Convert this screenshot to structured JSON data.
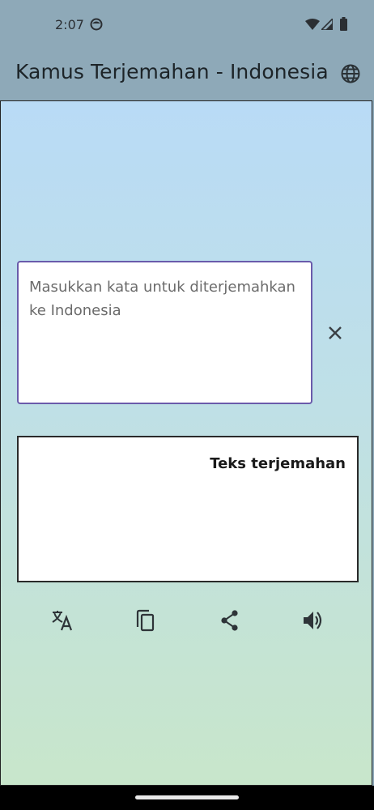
{
  "status_bar": {
    "time": "2:07",
    "icons": [
      "face-icon",
      "wifi-icon",
      "signal-icon",
      "battery-icon"
    ]
  },
  "app_bar": {
    "title": "Kamus Terjemahan - Indonesia",
    "language_button_icon": "globe-icon"
  },
  "input": {
    "placeholder": "Masukkan kata untuk diterjemahkan ke Indonesia",
    "value": "",
    "clear_icon": "close-icon"
  },
  "output": {
    "label": "Teks terjemahan"
  },
  "actions": [
    {
      "icon": "translate-icon"
    },
    {
      "icon": "copy-icon"
    },
    {
      "icon": "share-icon"
    },
    {
      "icon": "volume-icon"
    }
  ],
  "colors": {
    "app_bar": "#8ea9b8",
    "input_border": "#6a5bab",
    "output_border": "#2a2a2a",
    "gradient_top": "#b9dbf6",
    "gradient_bottom": "#c8e6cb"
  }
}
